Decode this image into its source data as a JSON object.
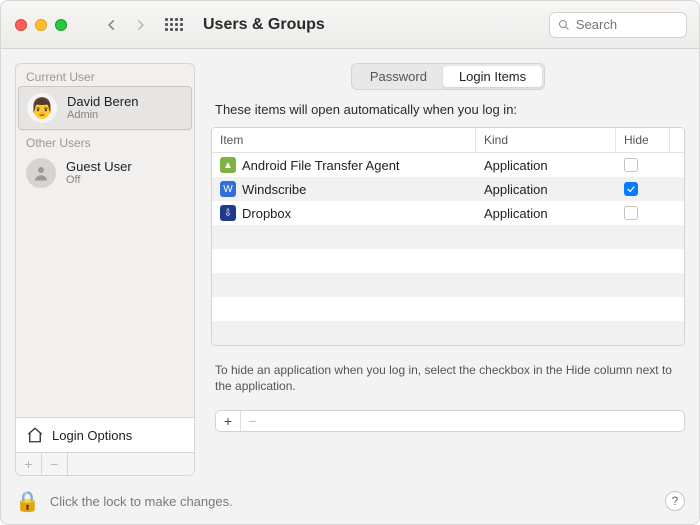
{
  "toolbar": {
    "title": "Users & Groups",
    "search_placeholder": "Search"
  },
  "sidebar": {
    "current_label": "Current User",
    "other_label": "Other Users",
    "current_user": {
      "name": "David Beren",
      "role": "Admin",
      "avatar": "👨"
    },
    "other_users": [
      {
        "name": "Guest User",
        "role": "Off"
      }
    ],
    "login_options_label": "Login Options",
    "plus": "+",
    "minus": "−"
  },
  "tabs": {
    "password": "Password",
    "login_items": "Login Items",
    "active": "login_items"
  },
  "main": {
    "description": "These items will open automatically when you log in:",
    "columns": {
      "item": "Item",
      "kind": "Kind",
      "hide": "Hide"
    },
    "rows": [
      {
        "icon": "green",
        "glyph": "▲",
        "name": "Android File Transfer Agent",
        "kind": "Application",
        "hide": false
      },
      {
        "icon": "blue",
        "glyph": "W",
        "name": "Windscribe",
        "kind": "Application",
        "hide": true
      },
      {
        "icon": "navy",
        "glyph": "⇩",
        "name": "Dropbox",
        "kind": "Application",
        "hide": false
      }
    ],
    "hint": "To hide an application when you log in, select the checkbox in the Hide column next to the application.",
    "plus": "+",
    "minus": "−"
  },
  "footer": {
    "lock_text": "Click the lock to make changes.",
    "help": "?"
  }
}
